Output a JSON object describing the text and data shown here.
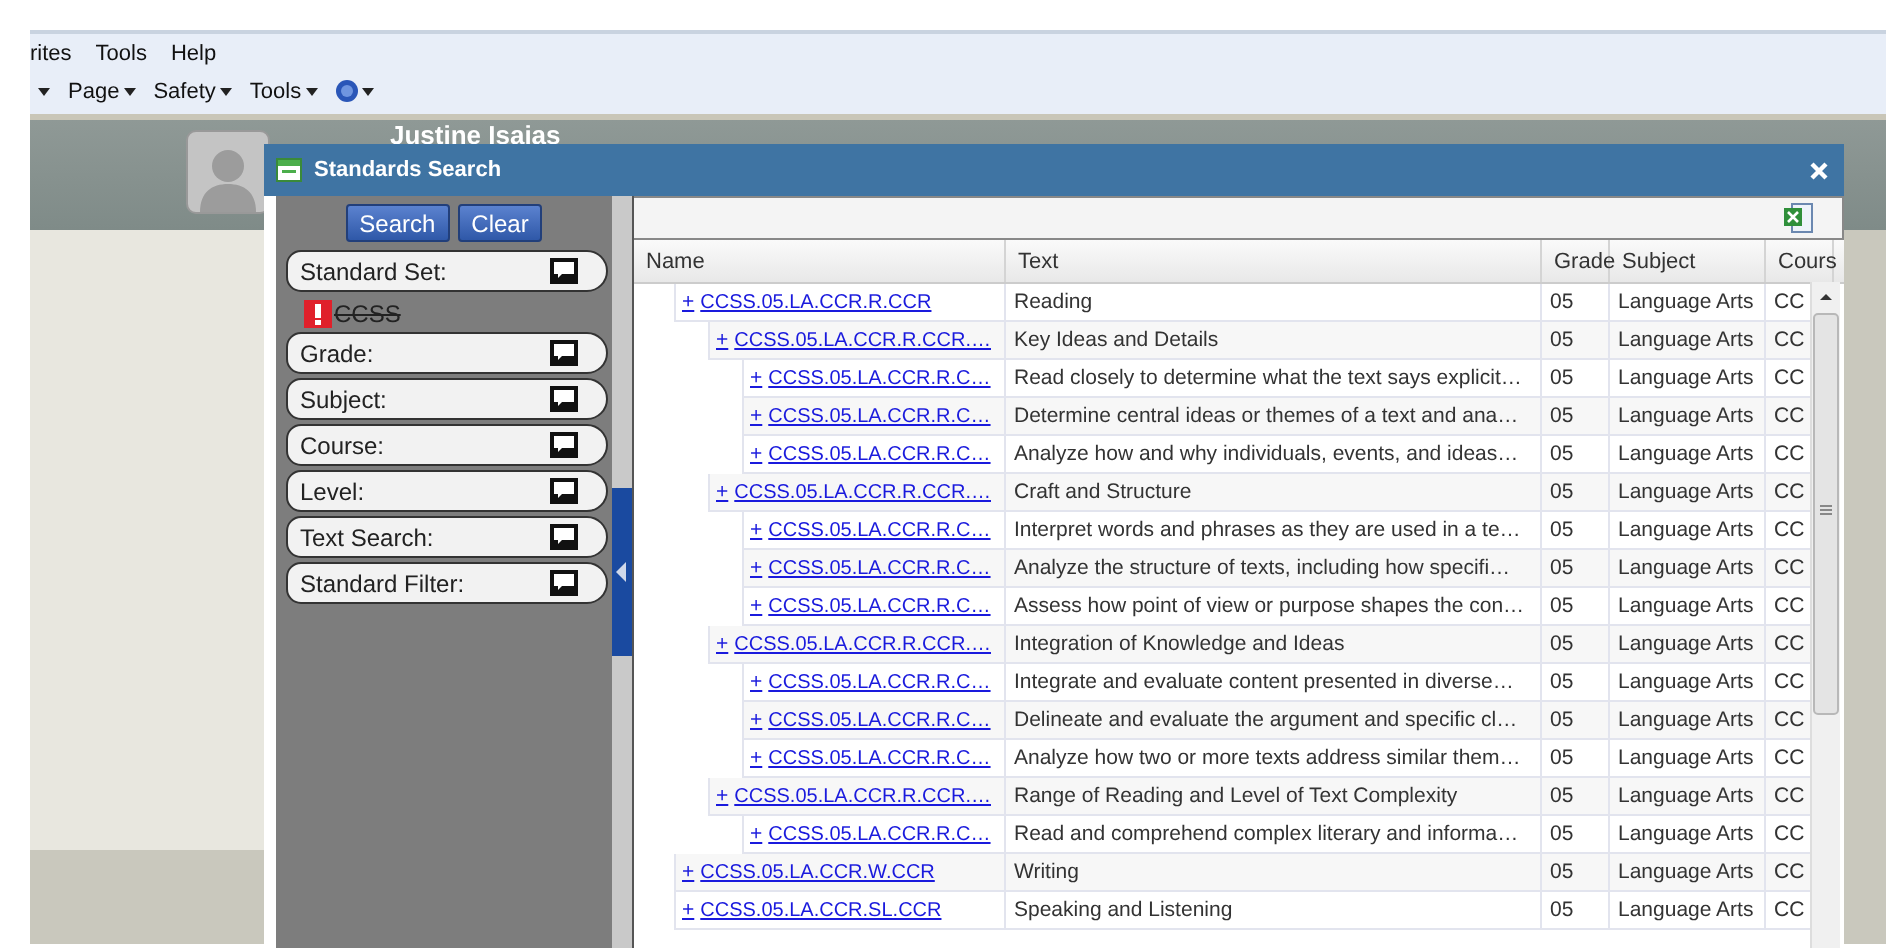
{
  "browser": {
    "menu": [
      "rites",
      "Tools",
      "Help"
    ],
    "toolbar": [
      {
        "label": "Page"
      },
      {
        "label": "Safety"
      },
      {
        "label": "Tools"
      }
    ]
  },
  "app": {
    "user_name": "Justine Isaias"
  },
  "dialog": {
    "title": "Standards Search",
    "buttons": [
      "Search",
      "Clear"
    ],
    "filters": [
      {
        "label": "Standard Set:",
        "value": "CCSS"
      },
      {
        "label": "Grade:"
      },
      {
        "label": "Subject:"
      },
      {
        "label": "Course:"
      },
      {
        "label": "Level:"
      },
      {
        "label": "Text Search:"
      },
      {
        "label": "Standard Filter:"
      }
    ],
    "grid": {
      "columns": [
        "Name",
        "Text",
        "Grade",
        "Subject",
        "Cours"
      ],
      "toggle": "+",
      "rows": [
        {
          "name": "CCSS.05.LA.CCR.R.CCR",
          "text": "Reading",
          "grade": "05",
          "subject": "Language Arts",
          "course": "CC",
          "children": [
            {
              "name": "CCSS.05.LA.CCR.R.CCR.…",
              "text": "Key Ideas and Details",
              "grade": "05",
              "subject": "Language Arts",
              "course": "CC",
              "children": [
                {
                  "name": "CCSS.05.LA.CCR.R.C…",
                  "text": "Read closely to determine what the text says explicit…",
                  "grade": "05",
                  "subject": "Language Arts",
                  "course": "CC"
                },
                {
                  "name": "CCSS.05.LA.CCR.R.C…",
                  "text": "Determine central ideas or themes of a text and ana…",
                  "grade": "05",
                  "subject": "Language Arts",
                  "course": "CC"
                },
                {
                  "name": "CCSS.05.LA.CCR.R.C…",
                  "text": "Analyze how and why individuals, events, and ideas…",
                  "grade": "05",
                  "subject": "Language Arts",
                  "course": "CC"
                }
              ]
            },
            {
              "name": "CCSS.05.LA.CCR.R.CCR.…",
              "text": "Craft and Structure",
              "grade": "05",
              "subject": "Language Arts",
              "course": "CC",
              "children": [
                {
                  "name": "CCSS.05.LA.CCR.R.C…",
                  "text": "Interpret words and phrases as they are used in a te…",
                  "grade": "05",
                  "subject": "Language Arts",
                  "course": "CC"
                },
                {
                  "name": "CCSS.05.LA.CCR.R.C…",
                  "text": "Analyze the structure of texts, including how specifi…",
                  "grade": "05",
                  "subject": "Language Arts",
                  "course": "CC"
                },
                {
                  "name": "CCSS.05.LA.CCR.R.C…",
                  "text": "Assess how point of view or purpose shapes the con…",
                  "grade": "05",
                  "subject": "Language Arts",
                  "course": "CC"
                }
              ]
            },
            {
              "name": "CCSS.05.LA.CCR.R.CCR.…",
              "text": "Integration of Knowledge and Ideas",
              "grade": "05",
              "subject": "Language Arts",
              "course": "CC",
              "children": [
                {
                  "name": "CCSS.05.LA.CCR.R.C…",
                  "text": "Integrate and evaluate content presented in diverse…",
                  "grade": "05",
                  "subject": "Language Arts",
                  "course": "CC"
                },
                {
                  "name": "CCSS.05.LA.CCR.R.C…",
                  "text": "Delineate and evaluate the argument and specific cl…",
                  "grade": "05",
                  "subject": "Language Arts",
                  "course": "CC"
                },
                {
                  "name": "CCSS.05.LA.CCR.R.C…",
                  "text": "Analyze how two or more texts address similar them…",
                  "grade": "05",
                  "subject": "Language Arts",
                  "course": "CC"
                }
              ]
            },
            {
              "name": "CCSS.05.LA.CCR.R.CCR.…",
              "text": "Range of Reading and Level of Text Complexity",
              "grade": "05",
              "subject": "Language Arts",
              "course": "CC",
              "children": [
                {
                  "name": "CCSS.05.LA.CCR.R.C…",
                  "text": "Read and comprehend complex literary and informa…",
                  "grade": "05",
                  "subject": "Language Arts",
                  "course": "CC"
                }
              ]
            }
          ]
        },
        {
          "name": "CCSS.05.LA.CCR.W.CCR",
          "text": "Writing",
          "grade": "05",
          "subject": "Language Arts",
          "course": "CC"
        },
        {
          "name": "CCSS.05.LA.CCR.SL.CCR",
          "text": "Speaking and Listening",
          "grade": "05",
          "subject": "Language Arts",
          "course": "CC"
        }
      ]
    }
  }
}
